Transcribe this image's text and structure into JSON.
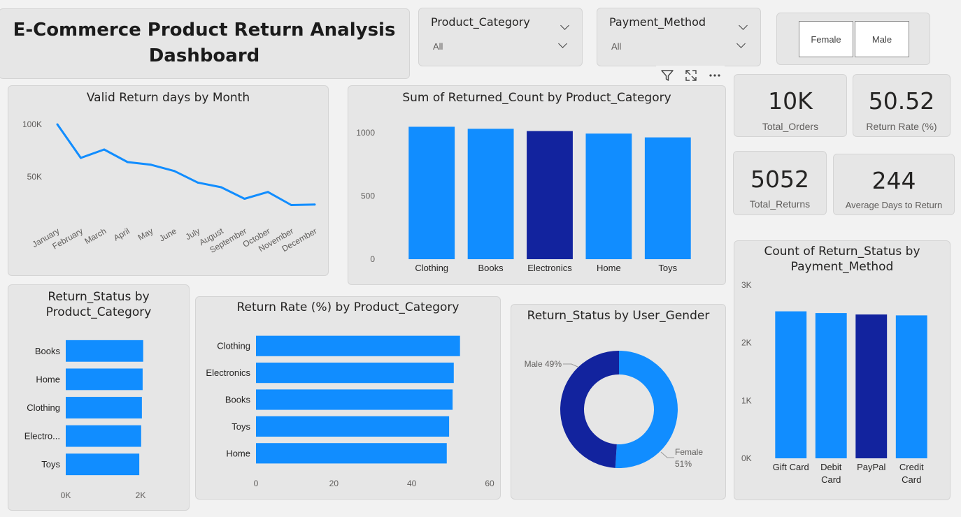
{
  "header": {
    "title_line1": "E-Commerce Product Return Analysis",
    "title_line2": "Dashboard"
  },
  "slicers": [
    {
      "name": "Product_Category",
      "value": "All"
    },
    {
      "name": "Payment_Method",
      "value": "All"
    }
  ],
  "gender_slicer": {
    "options": [
      "Female",
      "Male"
    ]
  },
  "visual_header_icons": [
    "filter-icon",
    "focus-mode-icon",
    "more-options-icon"
  ],
  "kpis": [
    {
      "value": "10K",
      "label": "Total_Orders"
    },
    {
      "value": "50.52",
      "label": "Return Rate (%)"
    },
    {
      "value": "5052",
      "label": "Total_Returns"
    },
    {
      "value": "244",
      "label": "Average Days to Return"
    }
  ],
  "colors": {
    "accent": "#118dff",
    "highlight": "#12239e",
    "card_bg": "#e6e6e6"
  },
  "chart_data": [
    {
      "id": "line_month",
      "type": "line",
      "title": "Valid Return days by Month",
      "categories": [
        "January",
        "February",
        "March",
        "April",
        "May",
        "June",
        "July",
        "August",
        "September",
        "October",
        "November",
        "December"
      ],
      "values": [
        100000,
        68000,
        76000,
        64000,
        61500,
        55500,
        44500,
        40000,
        29000,
        35500,
        23000,
        23500
      ],
      "yticks": [
        {
          "v": 50000,
          "label": "50K"
        },
        {
          "v": 100000,
          "label": "100K"
        }
      ],
      "ylim": [
        0,
        110000
      ],
      "grid": false
    },
    {
      "id": "bar_returned",
      "type": "bar",
      "title": "Sum of Returned_Count by Product_Category",
      "categories": [
        "Clothing",
        "Books",
        "Electronics",
        "Home",
        "Toys"
      ],
      "values": [
        1048,
        1032,
        1014,
        994,
        964
      ],
      "highlight_index": 2,
      "yticks": [
        0,
        500,
        1000
      ],
      "ylim": [
        0,
        1150
      ]
    },
    {
      "id": "hbar_status",
      "type": "bar",
      "orientation": "horizontal",
      "title_line1": "Return_Status by",
      "title_line2": "Product_Category",
      "categories": [
        "Books",
        "Home",
        "Clothing",
        "Electro...",
        "Toys"
      ],
      "values": [
        2070,
        2055,
        2035,
        2015,
        1965
      ],
      "xticks": [
        {
          "v": 0,
          "label": "0K"
        },
        {
          "v": 2000,
          "label": "2K"
        }
      ],
      "xlim": [
        0,
        2000
      ]
    },
    {
      "id": "hbar_rate",
      "type": "bar",
      "orientation": "horizontal",
      "title": "Return Rate (%) by Product_Category",
      "categories": [
        "Clothing",
        "Electronics",
        "Books",
        "Toys",
        "Home"
      ],
      "values": [
        52.4,
        50.8,
        50.5,
        49.6,
        49.0
      ],
      "xticks": [
        0,
        20,
        40,
        60
      ],
      "xlim": [
        0,
        60
      ]
    },
    {
      "id": "donut_gender",
      "type": "pie",
      "title": "Return_Status by User_Gender",
      "slices": [
        {
          "label": "Female",
          "pct_label": "51%",
          "value": 51,
          "color": "#118dff"
        },
        {
          "label": "Male",
          "pct_label": "49%",
          "value": 49,
          "color": "#12239e"
        }
      ]
    },
    {
      "id": "bar_payment",
      "type": "bar",
      "title_line1": "Count of Return_Status by",
      "title_line2": "Payment_Method",
      "categories": [
        [
          "Gift Card"
        ],
        [
          "Debit",
          "Card"
        ],
        [
          "PayPal"
        ],
        [
          "Credit",
          "Card"
        ]
      ],
      "values": [
        2545,
        2515,
        2490,
        2475
      ],
      "highlight_index": 2,
      "yticks": [
        {
          "v": 0,
          "label": "0K"
        },
        {
          "v": 1000,
          "label": "1K"
        },
        {
          "v": 2000,
          "label": "2K"
        },
        {
          "v": 3000,
          "label": "3K"
        }
      ],
      "ylim": [
        0,
        3000
      ]
    }
  ]
}
